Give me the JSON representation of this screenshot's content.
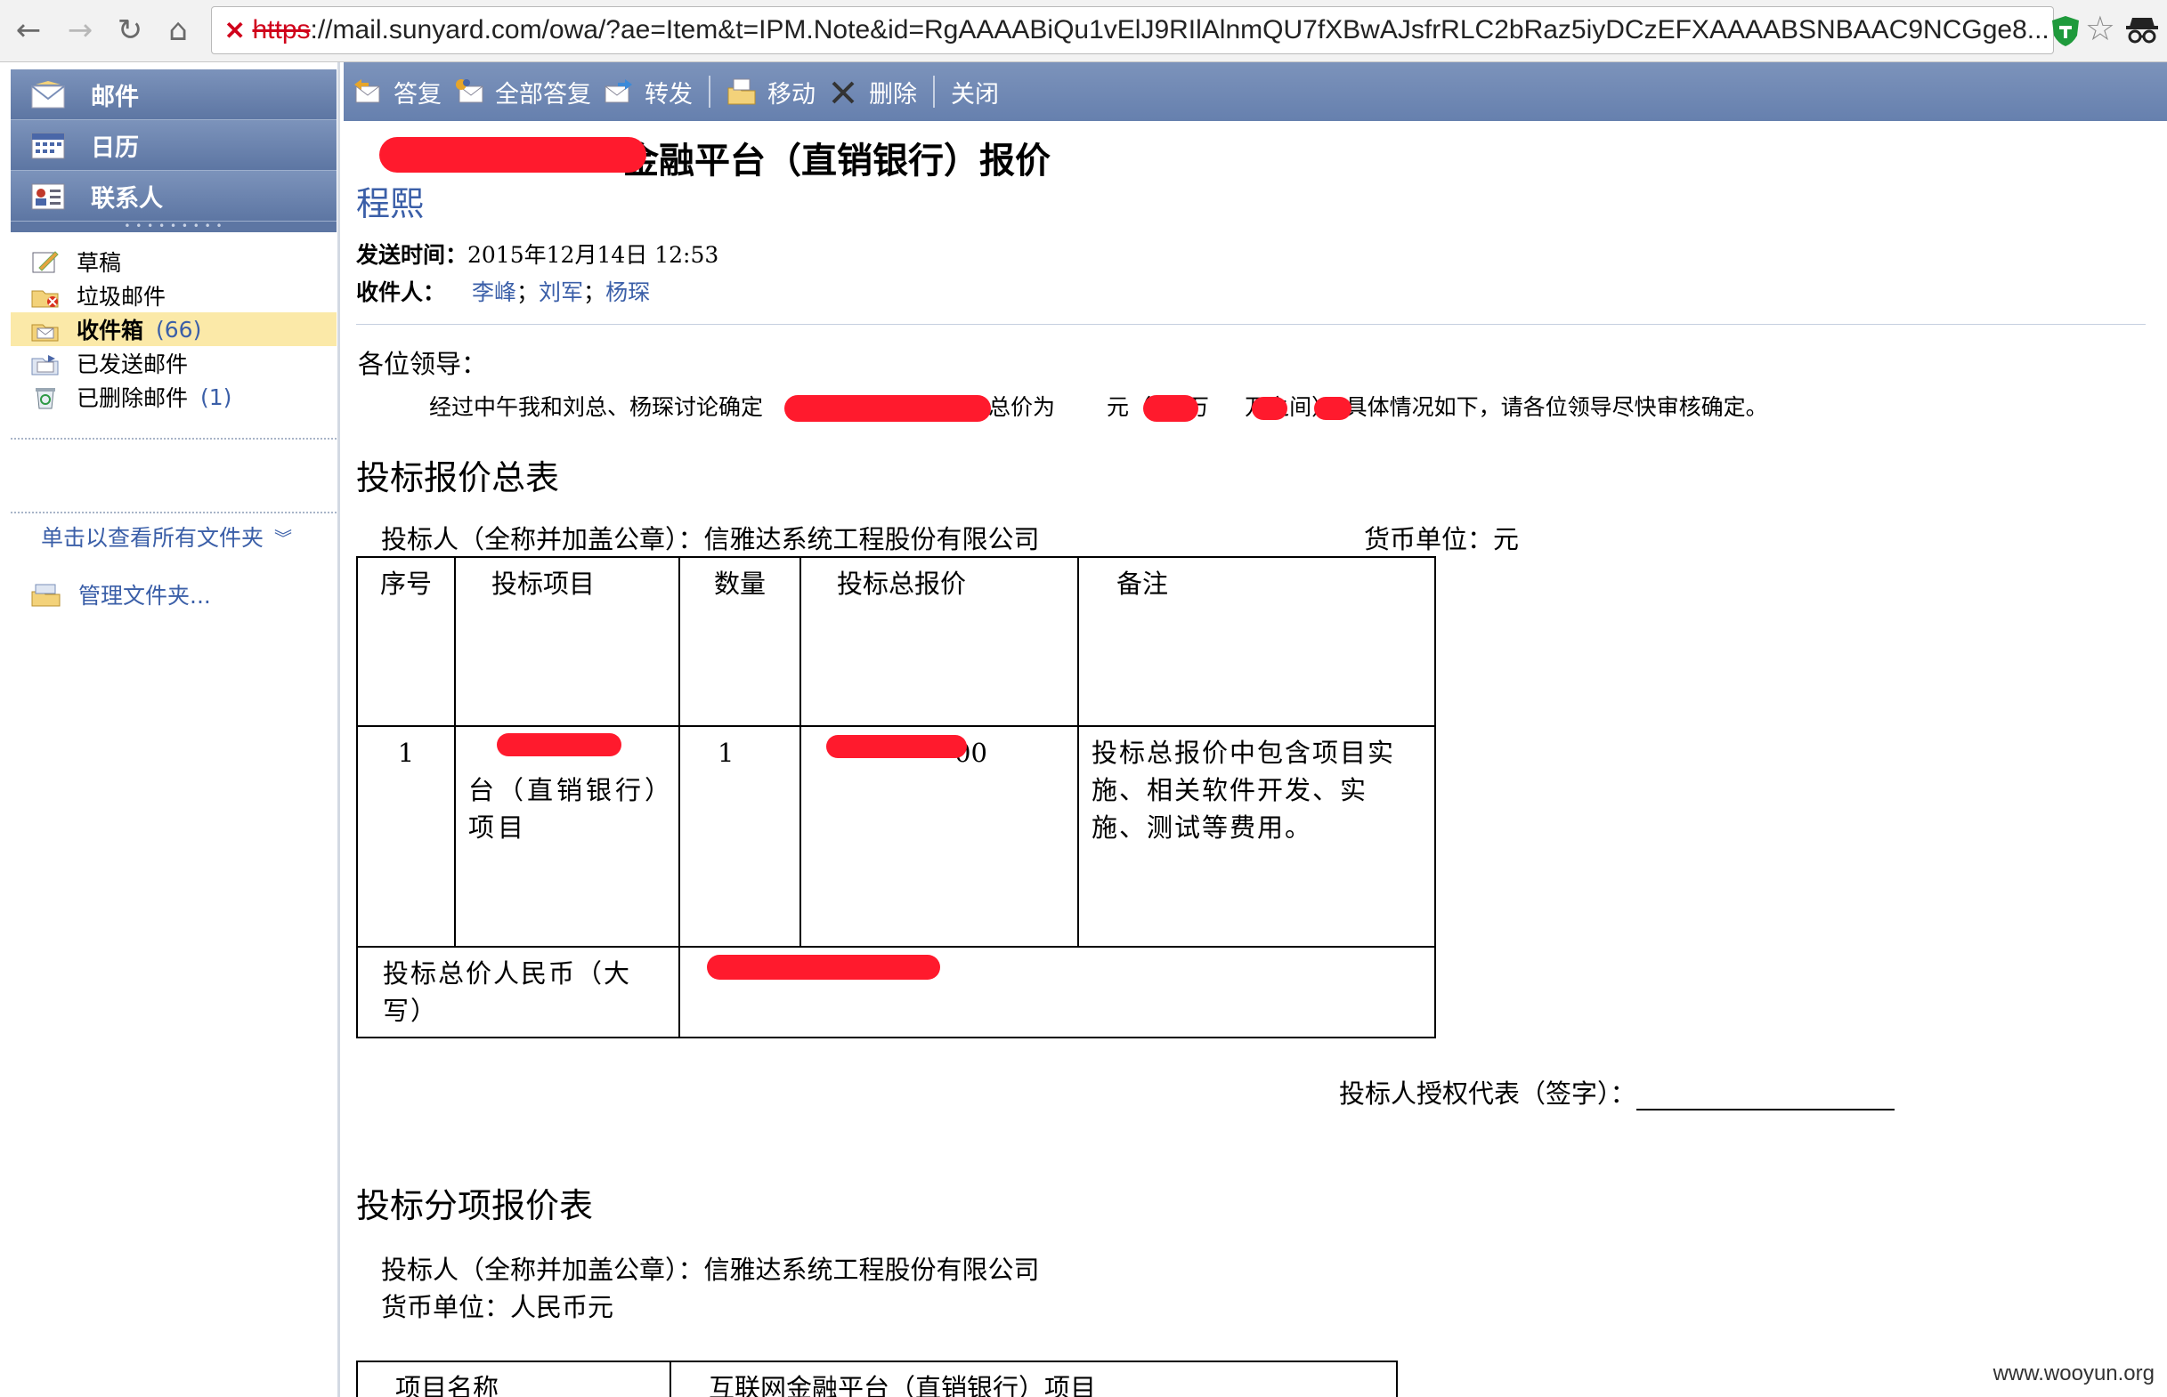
{
  "browser": {
    "url_scheme": "https",
    "url_rest": "://mail.sunyard.com/owa/?ae=Item&t=IPM.Note&id=RgAAAABiQu1vElJ9RIlAlnmQU7fXBwAJsfrRLC2bRaz5iyDCzEFXAAAABSNBAAC9NCGge8...",
    "nav": {
      "back": "←",
      "forward": "→",
      "reload": "↻",
      "home": "⌂"
    }
  },
  "leftnav": {
    "modules": [
      {
        "label": "邮件",
        "icon": "mail-icon"
      },
      {
        "label": "日历",
        "icon": "calendar-icon"
      },
      {
        "label": "联系人",
        "icon": "contacts-icon"
      }
    ],
    "folders": [
      {
        "label": "草稿",
        "icon": "drafts-icon",
        "count": ""
      },
      {
        "label": "垃圾邮件",
        "icon": "junk-icon",
        "count": ""
      },
      {
        "label": "收件箱",
        "icon": "inbox-icon",
        "count": "(66)",
        "selected": true
      },
      {
        "label": "已发送邮件",
        "icon": "sent-icon",
        "count": ""
      },
      {
        "label": "已删除邮件",
        "icon": "deleted-icon",
        "count": "(1)"
      }
    ],
    "all_folders_link": "单击以查看所有文件夹",
    "manage_folders_link": "管理文件夹..."
  },
  "toolbar": {
    "reply": "答复",
    "reply_all": "全部答复",
    "forward": "转发",
    "move": "移动",
    "delete": "删除",
    "close": "关闭"
  },
  "message": {
    "subject_visible": "金融平台（直销银行）报价",
    "sender": "程熙",
    "sent_label": "发送时间：",
    "sent_value": "2015年12月14日 12:53",
    "to_label": "收件人：",
    "recipients": [
      "李峰",
      "刘军",
      "杨琛"
    ],
    "greeting": "各位领导：",
    "body_part1": "经过中午我和刘总、杨琛讨论确定",
    "body_part2": "台总价为",
    "body_part3": "元（",
    "body_part4": "万",
    "body_part5": "万之间），具体情况如下，请各位领导尽快审核确定。",
    "section1_title": "投标报价总表",
    "bidder_line": "投标人（全称并加盖公章）：信雅达系统工程股份有限公司",
    "currency_line": "货币单位：元",
    "table1": {
      "headers": [
        "序号",
        "投标项目",
        "数量",
        "投标总报价",
        "备注"
      ],
      "row_no": "1",
      "row_project": "台（直销银行）项目",
      "row_qty": "1",
      "row_price_tail": "00",
      "row_note": "投标总报价中包含项目实施、相关软件开发、实施、测试等费用。",
      "total_label": "投标总价人民币（大写）"
    },
    "signature_label": "投标人授权代表（签字）：",
    "section2_title": "投标分项报价表",
    "bidder_line2": "投标人（全称并加盖公章）：信雅达系统工程股份有限公司",
    "currency_line2": "货币单位：人民币元",
    "table2": {
      "col1": "项目名称",
      "col2": "互联网金融平台（直销银行）项目"
    }
  },
  "watermark": "www.wooyun.org",
  "colors": {
    "nav": "#6680ae",
    "link": "#3b5fa8",
    "selected": "#fbe9a8",
    "redaction": "#ff1a2d"
  }
}
